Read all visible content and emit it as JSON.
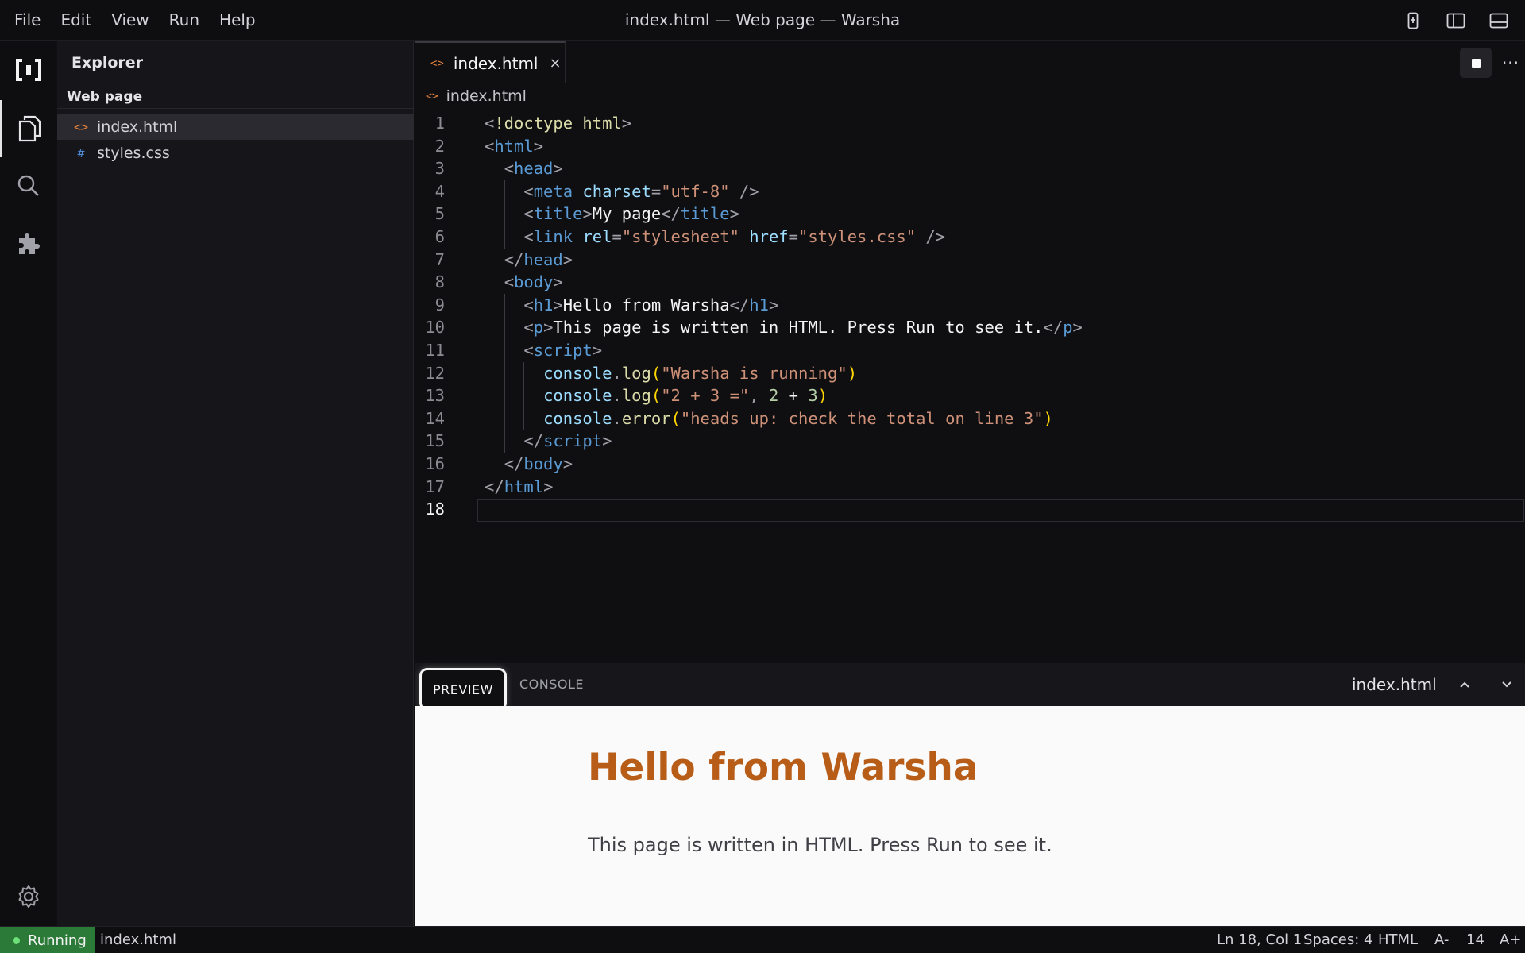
{
  "menu": [
    "File",
    "Edit",
    "View",
    "Run",
    "Help"
  ],
  "window_title": "index.html — Web page — Warsha",
  "titlebar_icons": [
    "device-icon",
    "sidebar-toggle-icon",
    "panel-toggle-icon"
  ],
  "activity": [
    "logo-icon",
    "files-icon",
    "search-icon",
    "extensions-icon",
    "settings-icon"
  ],
  "sidebar": {
    "title": "Explorer",
    "project": "Web page",
    "files": [
      {
        "name": "index.html",
        "icon": "<>",
        "icon_color": "#e0803a"
      },
      {
        "name": "styles.css",
        "icon": "#",
        "icon_color": "#4f8ad6"
      }
    ]
  },
  "editor": {
    "tab_label": "index.html",
    "tab_icon": "<>",
    "tab_close": "×",
    "breadcrumb": "index.html",
    "more": "···",
    "current_line": 18
  },
  "code_lines": [
    [
      [
        "t-punc",
        "<"
      ],
      [
        "t-doc",
        "!doctype html"
      ],
      [
        "t-punc",
        ">"
      ]
    ],
    [
      [
        "t-punc",
        "<"
      ],
      [
        "t-tag",
        "html"
      ],
      [
        "t-punc",
        ">"
      ]
    ],
    [
      [
        "t-text",
        "  "
      ],
      [
        "t-punc",
        "<"
      ],
      [
        "t-tag",
        "head"
      ],
      [
        "t-punc",
        ">"
      ]
    ],
    [
      [
        "t-text",
        "    "
      ],
      [
        "t-punc",
        "<"
      ],
      [
        "t-tag",
        "meta"
      ],
      [
        "t-text",
        " "
      ],
      [
        "t-attr",
        "charset"
      ],
      [
        "t-punc",
        "="
      ],
      [
        "t-str",
        "\"utf-8\""
      ],
      [
        "t-punc",
        " />"
      ]
    ],
    [
      [
        "t-text",
        "    "
      ],
      [
        "t-punc",
        "<"
      ],
      [
        "t-tag",
        "title"
      ],
      [
        "t-punc",
        ">"
      ],
      [
        "t-text",
        "My page"
      ],
      [
        "t-punc",
        "</"
      ],
      [
        "t-tag",
        "title"
      ],
      [
        "t-punc",
        ">"
      ]
    ],
    [
      [
        "t-text",
        "    "
      ],
      [
        "t-punc",
        "<"
      ],
      [
        "t-tag",
        "link"
      ],
      [
        "t-text",
        " "
      ],
      [
        "t-attr",
        "rel"
      ],
      [
        "t-punc",
        "="
      ],
      [
        "t-str",
        "\"stylesheet\""
      ],
      [
        "t-text",
        " "
      ],
      [
        "t-attr",
        "href"
      ],
      [
        "t-punc",
        "="
      ],
      [
        "t-str",
        "\"styles.css\""
      ],
      [
        "t-punc",
        " />"
      ]
    ],
    [
      [
        "t-text",
        "  "
      ],
      [
        "t-punc",
        "</"
      ],
      [
        "t-tag",
        "head"
      ],
      [
        "t-punc",
        ">"
      ]
    ],
    [
      [
        "t-text",
        "  "
      ],
      [
        "t-punc",
        "<"
      ],
      [
        "t-tag",
        "body"
      ],
      [
        "t-punc",
        ">"
      ]
    ],
    [
      [
        "t-text",
        "    "
      ],
      [
        "t-punc",
        "<"
      ],
      [
        "t-tag",
        "h1"
      ],
      [
        "t-punc",
        ">"
      ],
      [
        "t-text",
        "Hello from Warsha"
      ],
      [
        "t-punc",
        "</"
      ],
      [
        "t-tag",
        "h1"
      ],
      [
        "t-punc",
        ">"
      ]
    ],
    [
      [
        "t-text",
        "    "
      ],
      [
        "t-punc",
        "<"
      ],
      [
        "t-tag",
        "p"
      ],
      [
        "t-punc",
        ">"
      ],
      [
        "t-text",
        "This page is written in HTML. Press Run to see it."
      ],
      [
        "t-punc",
        "</"
      ],
      [
        "t-tag",
        "p"
      ],
      [
        "t-punc",
        ">"
      ]
    ],
    [
      [
        "t-text",
        "    "
      ],
      [
        "t-punc",
        "<"
      ],
      [
        "t-tag",
        "script"
      ],
      [
        "t-punc",
        ">"
      ]
    ],
    [
      [
        "t-text",
        "      "
      ],
      [
        "t-var",
        "console"
      ],
      [
        "t-punc",
        "."
      ],
      [
        "t-fn",
        "log"
      ],
      [
        "t-paren",
        "("
      ],
      [
        "t-str",
        "\"Warsha is running\""
      ],
      [
        "t-paren",
        ")"
      ]
    ],
    [
      [
        "t-text",
        "      "
      ],
      [
        "t-var",
        "console"
      ],
      [
        "t-punc",
        "."
      ],
      [
        "t-fn",
        "log"
      ],
      [
        "t-paren",
        "("
      ],
      [
        "t-str",
        "\"2 + 3 =\""
      ],
      [
        "t-punc",
        ", "
      ],
      [
        "t-num",
        "2"
      ],
      [
        "t-text",
        " + "
      ],
      [
        "t-num",
        "3"
      ],
      [
        "t-paren",
        ")"
      ]
    ],
    [
      [
        "t-text",
        "      "
      ],
      [
        "t-var",
        "console"
      ],
      [
        "t-punc",
        "."
      ],
      [
        "t-fn",
        "error"
      ],
      [
        "t-paren",
        "("
      ],
      [
        "t-str",
        "\"heads up: check the total on line 3\""
      ],
      [
        "t-paren",
        ")"
      ]
    ],
    [
      [
        "t-text",
        "    "
      ],
      [
        "t-punc",
        "</"
      ],
      [
        "t-tag",
        "script"
      ],
      [
        "t-punc",
        ">"
      ]
    ],
    [
      [
        "t-text",
        "  "
      ],
      [
        "t-punc",
        "</"
      ],
      [
        "t-tag",
        "body"
      ],
      [
        "t-punc",
        ">"
      ]
    ],
    [
      [
        "t-punc",
        "</"
      ],
      [
        "t-tag",
        "html"
      ],
      [
        "t-punc",
        ">"
      ]
    ],
    []
  ],
  "panel": {
    "tabs": [
      "PREVIEW",
      "CONSOLE"
    ],
    "active_tab": "PREVIEW",
    "file": "index.html"
  },
  "preview": {
    "h1": "Hello from Warsha",
    "p": "This page is written in HTML. Press Run to see it.",
    "h1_color": "#b85d18"
  },
  "status": {
    "running": "Running",
    "file": "index.html",
    "cursor": "Ln 18, Col 1",
    "spaces": "Spaces: 4",
    "language": "HTML",
    "font_decrease": "A-",
    "font_size": "14",
    "font_increase": "A+"
  }
}
